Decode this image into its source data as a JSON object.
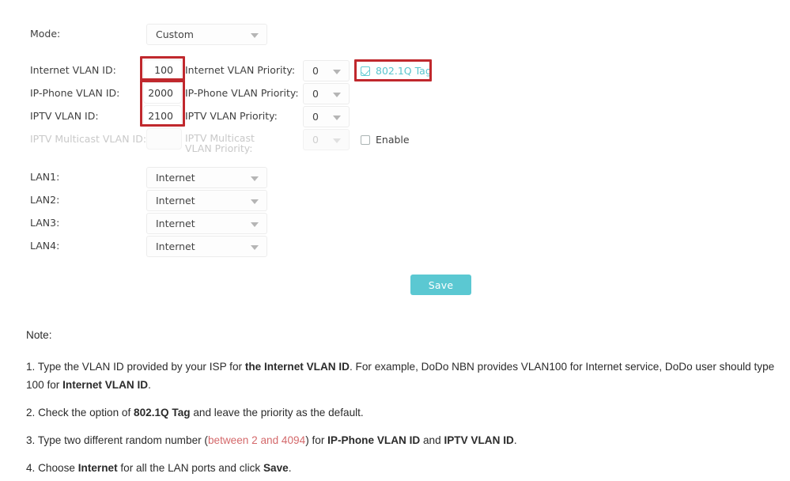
{
  "form": {
    "mode": {
      "label": "Mode:",
      "value": "Custom"
    },
    "rows": [
      {
        "id_label": "Internet VLAN ID:",
        "id_value": "100",
        "priority_label": "Internet VLAN Priority:",
        "priority_value": "0"
      },
      {
        "id_label": "IP-Phone VLAN ID:",
        "id_value": "2000",
        "priority_label": "IP-Phone VLAN Priority:",
        "priority_value": "0"
      },
      {
        "id_label": "IPTV VLAN ID:",
        "id_value": "2100",
        "priority_label": "IPTV VLAN Priority:",
        "priority_value": "0"
      },
      {
        "id_label": "IPTV Multicast VLAN ID:",
        "id_value": "",
        "priority_label": "IPTV Multicast VLAN Priority:",
        "priority_value": "0"
      }
    ],
    "tag_checkbox": {
      "label": "802.1Q Tag",
      "checked": true
    },
    "enable_checkbox": {
      "label": "Enable",
      "checked": false
    },
    "lan_ports": [
      {
        "label": "LAN1:",
        "value": "Internet"
      },
      {
        "label": "LAN2:",
        "value": "Internet"
      },
      {
        "label": "LAN3:",
        "value": "Internet"
      },
      {
        "label": "LAN4:",
        "value": "Internet"
      }
    ],
    "save_label": "Save"
  },
  "notes": {
    "heading": "Note:",
    "note1": {
      "a": "1. Type the VLAN ID provided by your ISP for ",
      "b1": "the Internet VLAN ID",
      "c": ". For example, DoDo NBN provides VLAN100 for Internet service, DoDo user should type 100 for ",
      "b2": "Internet VLAN ID",
      "d": "."
    },
    "note2": {
      "a": "2. Check the option of ",
      "b1": "802.1Q Tag",
      "c": " and leave the priority as the default."
    },
    "note3": {
      "a": "3. Type two different random number (",
      "red": "between 2 and 4094",
      "b": ") for ",
      "b1": "IP-Phone VLAN ID",
      "c": " and ",
      "b2": "IPTV VLAN ID",
      "d": "."
    },
    "note4": {
      "a": "4. Choose ",
      "b1": "Internet",
      "c": " for all the LAN ports and click ",
      "b2": "Save",
      "d": "."
    }
  },
  "colors": {
    "accent": "#5bc8d2",
    "annotation": "#c0282d",
    "note_red": "#d4696b"
  }
}
